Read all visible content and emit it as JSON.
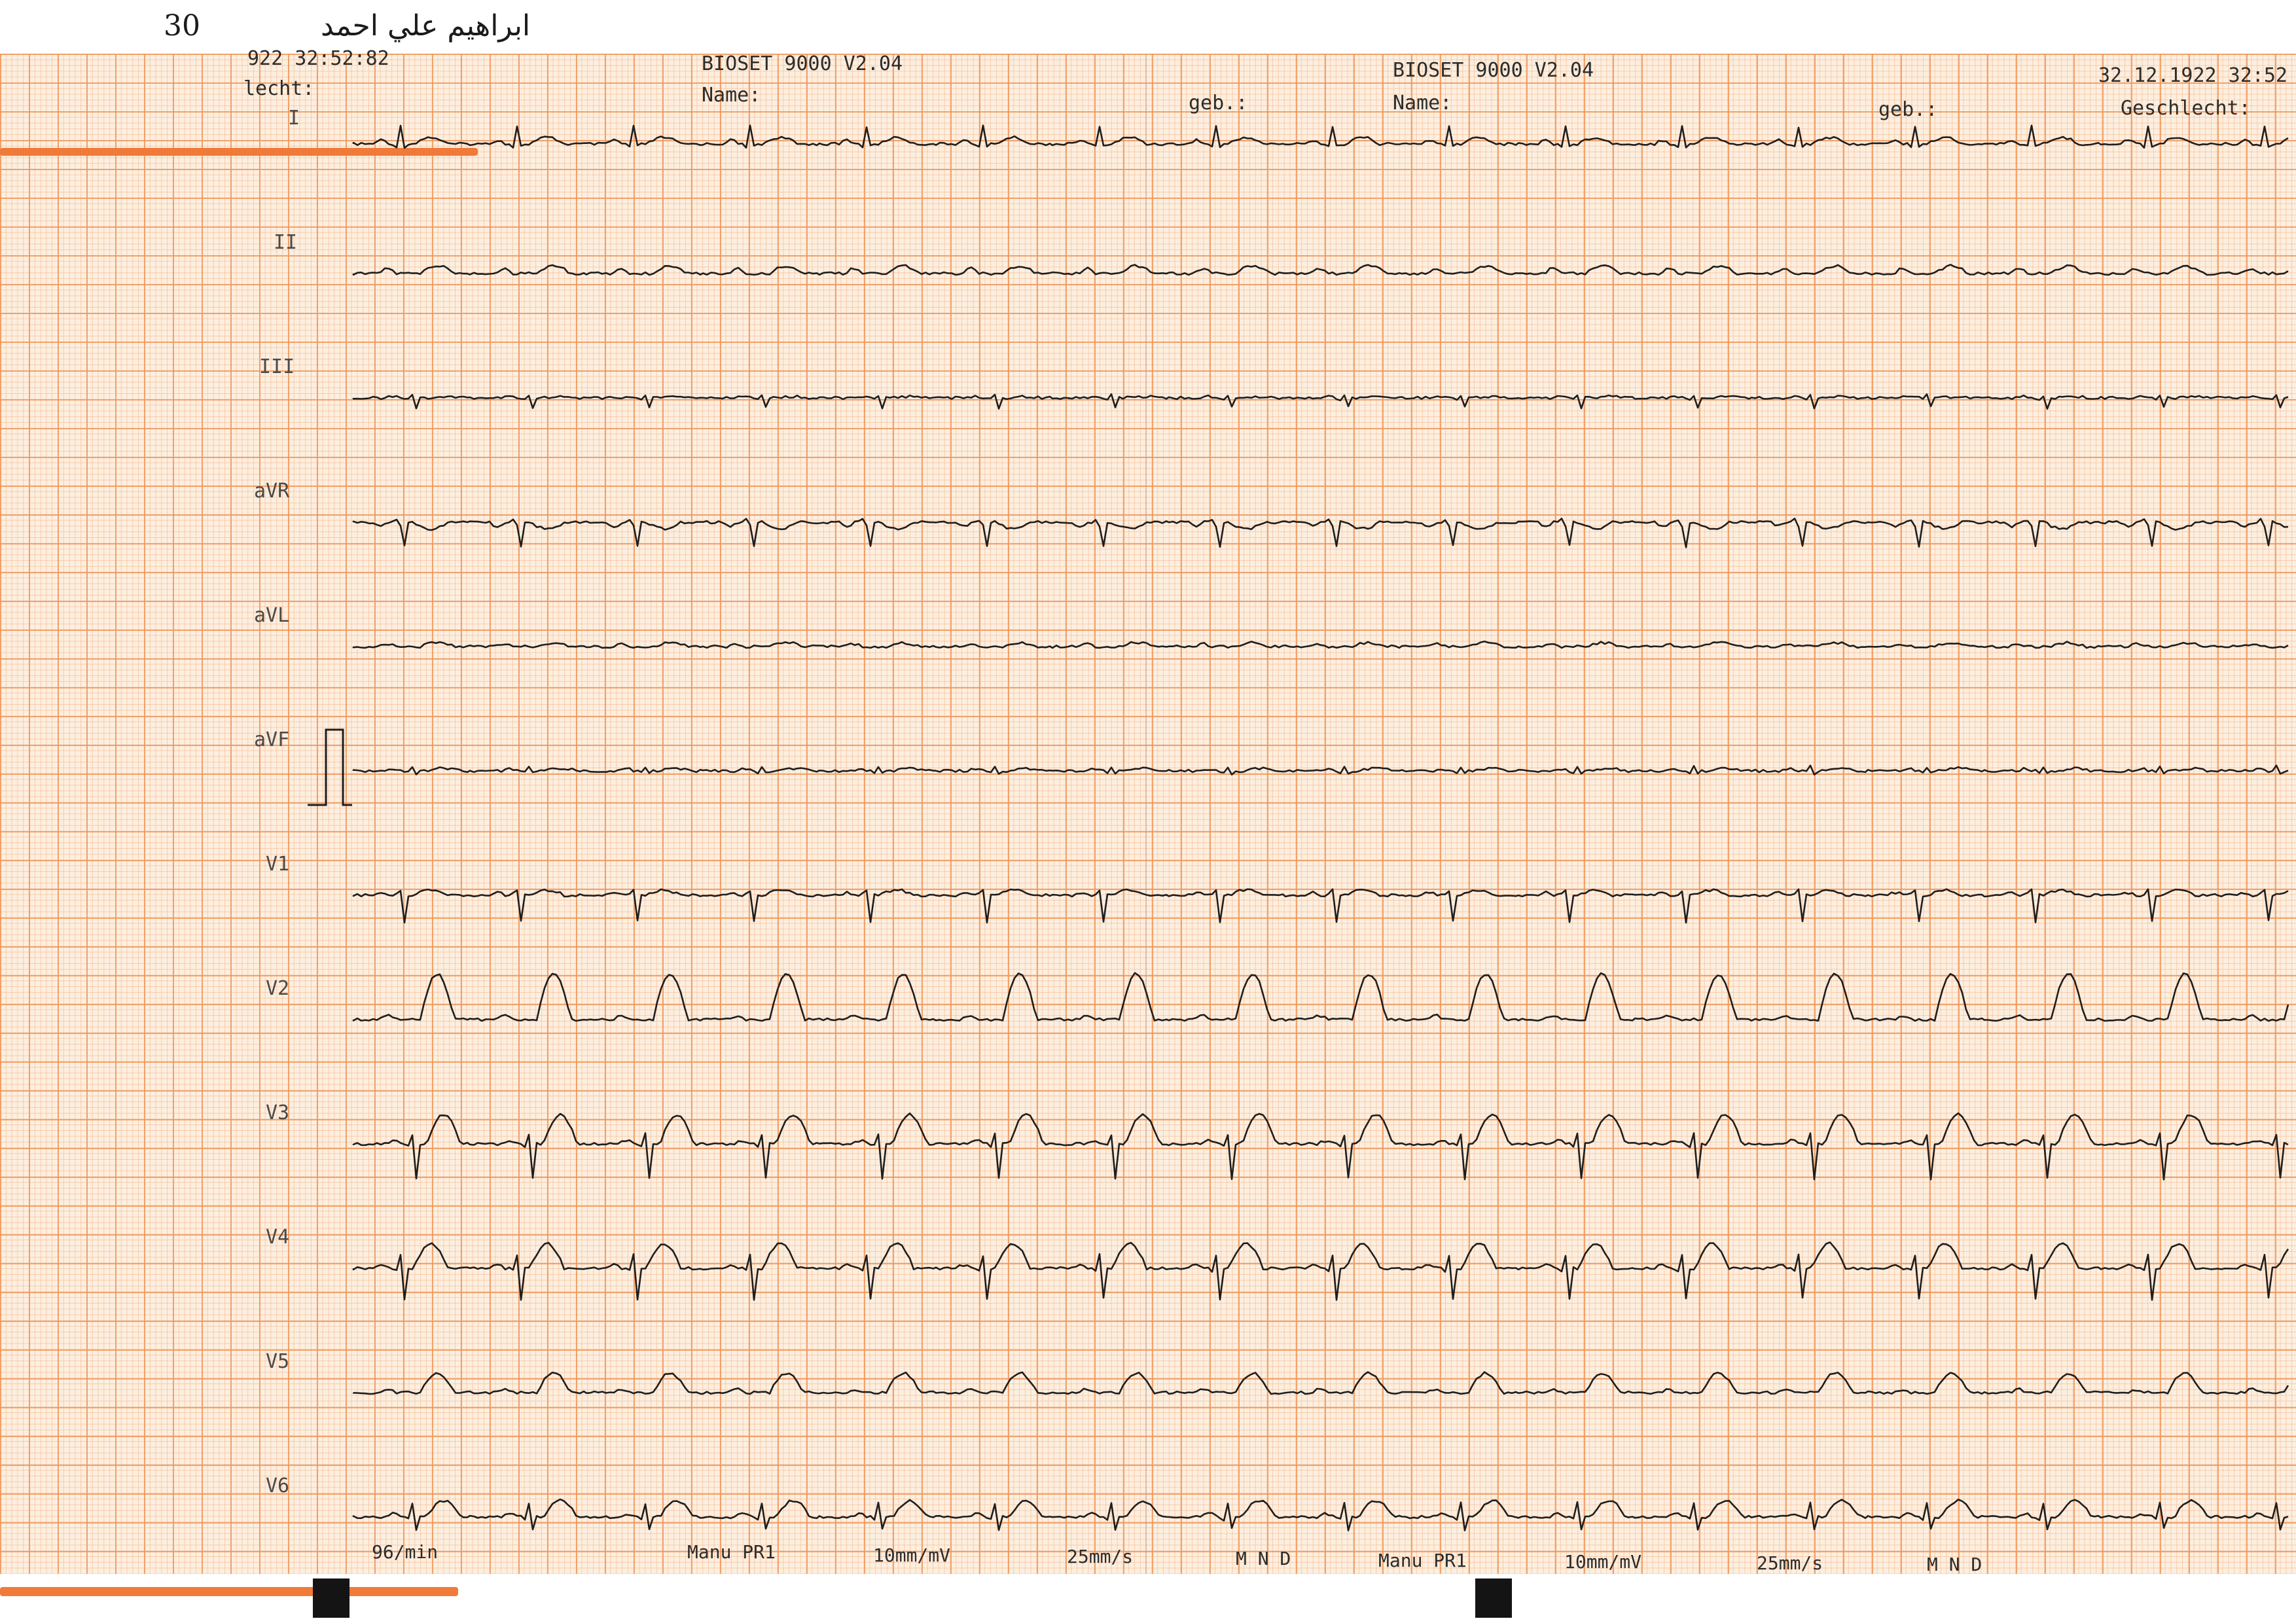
{
  "handwriting": {
    "number": "30",
    "arabic": "ابراهيم علي احمد"
  },
  "header_left": {
    "datetime": "922 32:52:82",
    "device": "BIOSET 9000 V2.04",
    "name_label": "Name:",
    "sex_label": "lecht:",
    "born_label": "geb.:"
  },
  "header_right": {
    "device": "BIOSET 9000 V2.04",
    "name_label": "Name:",
    "born_label": "geb.:",
    "datetime": "32.12.1922 32:52",
    "sex_label": "Geschlecht:"
  },
  "leads": [
    "I",
    "II",
    "III",
    "aVR",
    "aVL",
    "aVF",
    "V1",
    "V2",
    "V3",
    "V4",
    "V5",
    "V6"
  ],
  "footer_left": {
    "heart_rate": "96/min",
    "program": "Manu PR1",
    "gain": "10mm/mV",
    "speed": "25mm/s",
    "filters": "M  N  D"
  },
  "footer_right": {
    "program": "Manu PR1",
    "gain": "10mm/mV",
    "speed": "25mm/s",
    "filters": "M  N  D"
  },
  "colors": {
    "grid_major": "#f0965a",
    "grid_minor": "#f5af82",
    "paper": "#fcefe0",
    "marker_strip": "#f07a3a",
    "trace": "#1e1e1e"
  }
}
